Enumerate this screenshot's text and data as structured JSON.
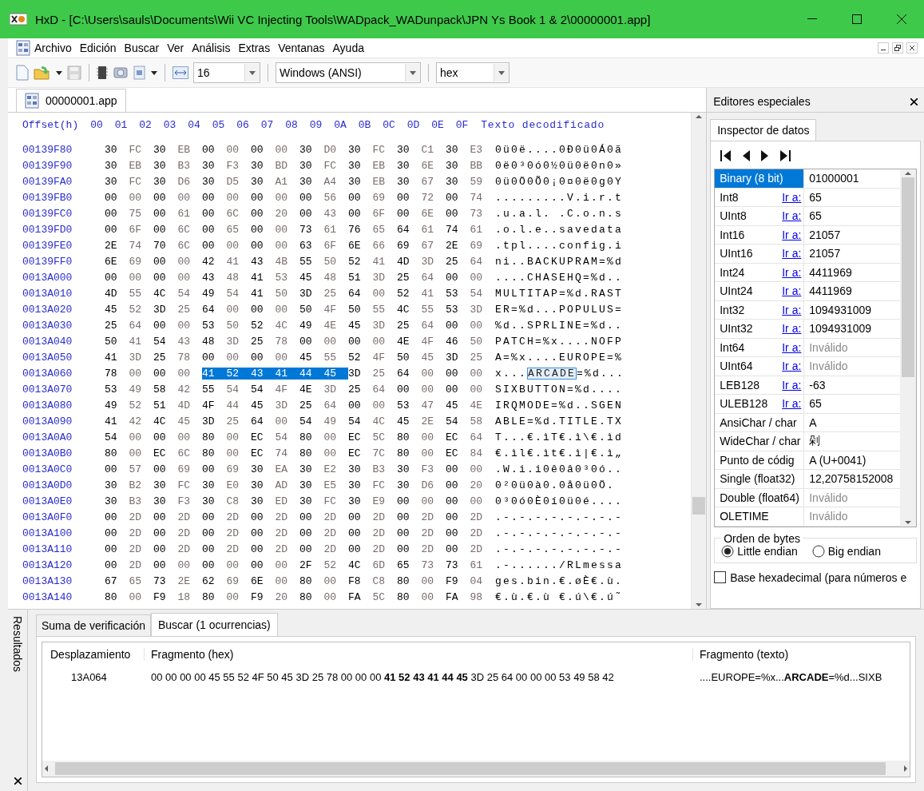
{
  "window": {
    "title": "HxD - [C:\\Users\\sauls\\Documents\\Wii VC Injecting Tools\\WADpack_WADunpack\\JPN Ys Book 1 & 2\\00000001.app]"
  },
  "menu": [
    "Archivo",
    "Edición",
    "Buscar",
    "Ver",
    "Análisis",
    "Extras",
    "Ventanas",
    "Ayuda"
  ],
  "toolbar": {
    "bytes_per_row": "16",
    "charset": "Windows (ANSI)",
    "display_mode": "hex"
  },
  "document_tab": {
    "label": "00000001.app",
    "selected": true
  },
  "hex_view": {
    "offset_header": "Offset(h)",
    "columns": [
      "00",
      "01",
      "02",
      "03",
      "04",
      "05",
      "06",
      "07",
      "08",
      "09",
      "0A",
      "0B",
      "0C",
      "0D",
      "0E",
      "0F"
    ],
    "text_header": "Texto decodificado",
    "rows": [
      {
        "offset": "00139F80",
        "bytes": [
          {
            "hex": "30 FC 30 EB 00 00 00 00 30 D0 30 FC 30 C1 30 E3",
            "selected": false
          }
        ],
        "text": [
          {
            "chars": "0ü0ë....0Ð0ü0Á0ã",
            "selected": false
          }
        ]
      },
      {
        "offset": "00139F90",
        "bytes": [
          {
            "hex": "30 EB 30 B3 30 F3 30 BD 30 FC 30 EB 30 6E 30 BB",
            "selected": false
          }
        ],
        "text": [
          {
            "chars": "0ë0³0ó0½0ü0ë0n0»",
            "selected": false
          }
        ]
      },
      {
        "offset": "00139FA0",
        "bytes": [
          {
            "hex": "30 FC 30 D6 30 D5 30 A1 30 A4 30 EB 30 67 30 59",
            "selected": false
          }
        ],
        "text": [
          {
            "chars": "0ü0Ö0Õ0¡0¤0ë0g0Y",
            "selected": false
          }
        ]
      },
      {
        "offset": "00139FB0",
        "bytes": [
          {
            "hex": "00 00 00 00 00 00 00 00 00 56 00 69 00 72 00 74",
            "selected": false
          }
        ],
        "text": [
          {
            "chars": ".........V.i.r.t",
            "selected": false
          }
        ]
      },
      {
        "offset": "00139FC0",
        "bytes": [
          {
            "hex": "00 75 00 61 00 6C 00 20 00 43 00 6F 00 6E 00 73",
            "selected": false
          }
        ],
        "text": [
          {
            "chars": ".u.a.l. .C.o.n.s",
            "selected": false
          }
        ]
      },
      {
        "offset": "00139FD0",
        "bytes": [
          {
            "hex": "00 6F 00 6C 00 65 00 00 73 61 76 65 64 61 74 61",
            "selected": false
          }
        ],
        "text": [
          {
            "chars": ".o.l.e..savedata",
            "selected": false
          }
        ]
      },
      {
        "offset": "00139FE0",
        "bytes": [
          {
            "hex": "2E 74 70 6C 00 00 00 00 63 6F 6E 66 69 67 2E 69",
            "selected": false
          }
        ],
        "text": [
          {
            "chars": ".tpl....config.i",
            "selected": false
          }
        ]
      },
      {
        "offset": "00139FF0",
        "bytes": [
          {
            "hex": "6E 69 00 00 42 41 43 4B 55 50 52 41 4D 3D 25 64",
            "selected": false
          }
        ],
        "text": [
          {
            "chars": "ni..BACKUPRAM=%d",
            "selected": false
          }
        ]
      },
      {
        "offset": "0013A000",
        "bytes": [
          {
            "hex": "00 00 00 00 43 48 41 53 45 48 51 3D 25 64 00 00",
            "selected": false
          }
        ],
        "text": [
          {
            "chars": "....CHASEHQ=%d..",
            "selected": false
          }
        ]
      },
      {
        "offset": "0013A010",
        "bytes": [
          {
            "hex": "4D 55 4C 54 49 54 41 50 3D 25 64 00 52 41 53 54",
            "selected": false
          }
        ],
        "text": [
          {
            "chars": "MULTITAP=%d.RAST",
            "selected": false
          }
        ]
      },
      {
        "offset": "0013A020",
        "bytes": [
          {
            "hex": "45 52 3D 25 64 00 00 00 50 4F 50 55 4C 55 53 3D",
            "selected": false
          }
        ],
        "text": [
          {
            "chars": "ER=%d...POPULUS=",
            "selected": false
          }
        ]
      },
      {
        "offset": "0013A030",
        "bytes": [
          {
            "hex": "25 64 00 00 53 50 52 4C 49 4E 45 3D 25 64 00 00",
            "selected": false
          }
        ],
        "text": [
          {
            "chars": "%d..SPRLINE=%d..",
            "selected": false
          }
        ]
      },
      {
        "offset": "0013A040",
        "bytes": [
          {
            "hex": "50 41 54 43 48 3D 25 78 00 00 00 00 4E 4F 46 50",
            "selected": false
          }
        ],
        "text": [
          {
            "chars": "PATCH=%x....NOFP",
            "selected": false
          }
        ]
      },
      {
        "offset": "0013A050",
        "bytes": [
          {
            "hex": "41 3D 25 78 00 00 00 00 45 55 52 4F 50 45 3D 25",
            "selected": false
          }
        ],
        "text": [
          {
            "chars": "A=%x....EUROPE=%",
            "selected": false
          }
        ]
      },
      {
        "offset": "0013A060",
        "bytes": [
          {
            "hex": "78 00 00 00",
            "selected": false
          },
          {
            "hex": "41 52 43 41 44 45",
            "selected": true
          },
          {
            "hex": "3D 25 64 00 00 00",
            "selected": false
          }
        ],
        "text": [
          {
            "chars": "x...",
            "selected": false
          },
          {
            "chars": "ARCADE",
            "selected": true
          },
          {
            "chars": "=%d...",
            "selected": false
          }
        ]
      },
      {
        "offset": "0013A070",
        "bytes": [
          {
            "hex": "53 49 58 42 55 54 54 4F 4E 3D 25 64 00 00 00 00",
            "selected": false
          }
        ],
        "text": [
          {
            "chars": "SIXBUTTON=%d....",
            "selected": false
          }
        ]
      },
      {
        "offset": "0013A080",
        "bytes": [
          {
            "hex": "49 52 51 4D 4F 44 45 3D 25 64 00 00 53 47 45 4E",
            "selected": false
          }
        ],
        "text": [
          {
            "chars": "IRQMODE=%d..SGEN",
            "selected": false
          }
        ]
      },
      {
        "offset": "0013A090",
        "bytes": [
          {
            "hex": "41 42 4C 45 3D 25 64 00 54 49 54 4C 45 2E 54 58",
            "selected": false
          }
        ],
        "text": [
          {
            "chars": "ABLE=%d.TITLE.TX",
            "selected": false
          }
        ]
      },
      {
        "offset": "0013A0A0",
        "bytes": [
          {
            "hex": "54 00 00 00 80 00 EC 54 80 00 EC 5C 80 00 EC 64",
            "selected": false
          }
        ],
        "text": [
          {
            "chars": "T...€.ìT€.ì\\€.ìd",
            "selected": false
          }
        ]
      },
      {
        "offset": "0013A0B0",
        "bytes": [
          {
            "hex": "80 00 EC 6C 80 00 EC 74 80 00 EC 7C 80 00 EC 84",
            "selected": false
          }
        ],
        "text": [
          {
            "chars": "€.ìl€.ìt€.ì|€.ì„",
            "selected": false
          }
        ]
      },
      {
        "offset": "0013A0C0",
        "bytes": [
          {
            "hex": "00 57 00 69 00 69 30 EA 30 E2 30 B3 30 F3 00 00",
            "selected": false
          }
        ],
        "text": [
          {
            "chars": ".W.i.i0ê0â0³0ó..",
            "selected": false
          }
        ]
      },
      {
        "offset": "0013A0D0",
        "bytes": [
          {
            "hex": "30 B2 30 FC 30 E0 30 AD 30 E5 30 FC 30 D6 00 20",
            "selected": false
          }
        ],
        "text": [
          {
            "chars": "0²0ü0à0.0å0ü0Ö.",
            "selected": false
          }
        ]
      },
      {
        "offset": "0013A0E0",
        "bytes": [
          {
            "hex": "30 B3 30 F3 30 C8 30 ED 30 FC 30 E9 00 00 00 00",
            "selected": false
          }
        ],
        "text": [
          {
            "chars": "0³0ó0È0í0ü0é....",
            "selected": false
          }
        ]
      },
      {
        "offset": "0013A0F0",
        "bytes": [
          {
            "hex": "00 2D 00 2D 00 2D 00 2D 00 2D 00 2D 00 2D 00 2D",
            "selected": false
          }
        ],
        "text": [
          {
            "chars": ".-.-.-.-.-.-.-.-",
            "selected": false
          }
        ]
      },
      {
        "offset": "0013A100",
        "bytes": [
          {
            "hex": "00 2D 00 2D 00 2D 00 2D 00 2D 00 2D 00 2D 00 2D",
            "selected": false
          }
        ],
        "text": [
          {
            "chars": ".-.-.-.-.-.-.-.-",
            "selected": false
          }
        ]
      },
      {
        "offset": "0013A110",
        "bytes": [
          {
            "hex": "00 2D 00 2D 00 2D 00 2D 00 2D 00 2D 00 2D 00 2D",
            "selected": false
          }
        ],
        "text": [
          {
            "chars": ".-.-.-.-.-.-.-.-",
            "selected": false
          }
        ]
      },
      {
        "offset": "0013A120",
        "bytes": [
          {
            "hex": "00 2D 00 00 00 00 00 00 2F 52 4C 6D 65 73 73 61",
            "selected": false
          }
        ],
        "text": [
          {
            "chars": ".-....../RLmessa",
            "selected": false
          }
        ]
      },
      {
        "offset": "0013A130",
        "bytes": [
          {
            "hex": "67 65 73 2E 62 69 6E 00 80 00 F8 C8 80 00 F9 04",
            "selected": false
          }
        ],
        "text": [
          {
            "chars": "ges.bin.€.øÈ€.ù.",
            "selected": false
          }
        ]
      },
      {
        "offset": "0013A140",
        "bytes": [
          {
            "hex": "80 00 F9 18 80 00 F9 20 80 00 FA 5C 80 00 FA 98",
            "selected": false
          }
        ],
        "text": [
          {
            "chars": "€.ù.€.ù €.ú\\€.ú˜",
            "selected": false
          }
        ]
      }
    ]
  },
  "special_editors": {
    "title": "Editores especiales",
    "tab": "Inspector de datos",
    "rows": [
      {
        "name": "Binary (8 bit)",
        "value": "01000001",
        "invalid": false,
        "selected": true
      },
      {
        "name": "Int8",
        "goto": "Ir a:",
        "value": "65",
        "invalid": false,
        "selected": false
      },
      {
        "name": "UInt8",
        "goto": "Ir a:",
        "value": "65",
        "invalid": false,
        "selected": false
      },
      {
        "name": "Int16",
        "goto": "Ir a:",
        "value": "21057",
        "invalid": false,
        "selected": false
      },
      {
        "name": "UInt16",
        "goto": "Ir a:",
        "value": "21057",
        "invalid": false,
        "selected": false
      },
      {
        "name": "Int24",
        "goto": "Ir a:",
        "value": "4411969",
        "invalid": false,
        "selected": false
      },
      {
        "name": "UInt24",
        "goto": "Ir a:",
        "value": "4411969",
        "invalid": false,
        "selected": false
      },
      {
        "name": "Int32",
        "goto": "Ir a:",
        "value": "1094931009",
        "invalid": false,
        "selected": false
      },
      {
        "name": "UInt32",
        "goto": "Ir a:",
        "value": "1094931009",
        "invalid": false,
        "selected": false
      },
      {
        "name": "Int64",
        "goto": "Ir a:",
        "value": "Inválido",
        "invalid": true,
        "selected": false
      },
      {
        "name": "UInt64",
        "goto": "Ir a:",
        "value": "Inválido",
        "invalid": true,
        "selected": false
      },
      {
        "name": "LEB128",
        "goto": "Ir a:",
        "value": "-63",
        "invalid": false,
        "selected": false
      },
      {
        "name": "ULEB128",
        "goto": "Ir a:",
        "value": "65",
        "invalid": false,
        "selected": false
      },
      {
        "name": "AnsiChar / char",
        "value": "A",
        "invalid": false,
        "selected": false
      },
      {
        "name": "WideChar / char",
        "value": "剁",
        "invalid": false,
        "selected": false
      },
      {
        "name": "Punto de códig",
        "value": "A (U+0041)",
        "invalid": false,
        "selected": false
      },
      {
        "name": "Single (float32)",
        "value": "12,20758152008",
        "invalid": false,
        "selected": false
      },
      {
        "name": "Double (float64)",
        "value": "Inválido",
        "invalid": true,
        "selected": false
      },
      {
        "name": "OLETIME",
        "value": "Inválido",
        "invalid": true,
        "selected": false
      }
    ],
    "byte_order": {
      "title": "Orden de bytes",
      "options": [
        {
          "label": "Little endian",
          "selected": true
        },
        {
          "label": "Big endian",
          "selected": false
        }
      ]
    },
    "hex_base": {
      "label": "Base hexadecimal (para números e",
      "checked": false
    }
  },
  "results": {
    "title": "Resultados",
    "tabs": [
      {
        "label": "Suma de verificación",
        "selected": false
      },
      {
        "label": "Buscar (1 ocurrencias)",
        "selected": true
      }
    ],
    "columns": [
      "Desplazamiento",
      "Fragmento (hex)",
      "Fragmento (texto)"
    ],
    "rows": [
      {
        "offset": "13A064",
        "hex": "00 00 00 00 45 55 52 4F 50 45 3D 25 78 00 00 00 **41 52 43 41 44 45** 3D 25 64 00 00 00 53 49 58 42",
        "text": "....EUROPE=%x...**ARCADE**=%d...SIXB"
      }
    ]
  }
}
